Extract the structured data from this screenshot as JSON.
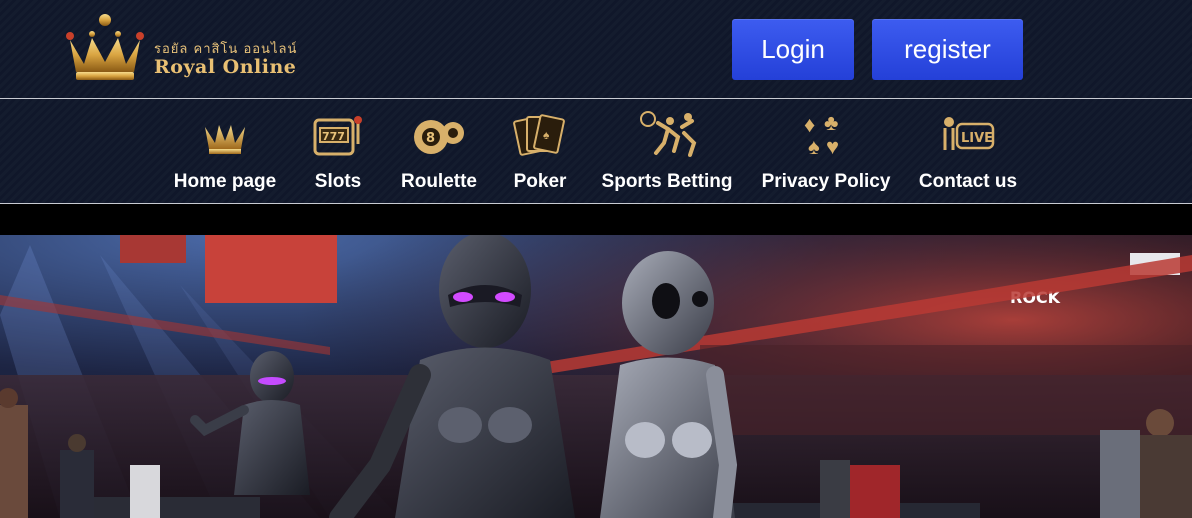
{
  "header": {
    "logo_thai": "รอยัล คาสิโน ออนไลน์",
    "logo_text": "Royal Online",
    "login_label": "Login",
    "register_label": "register"
  },
  "nav": {
    "items": [
      {
        "label": "Home page",
        "icon": "crown-icon"
      },
      {
        "label": "Slots",
        "icon": "slot-machine-icon"
      },
      {
        "label": "Roulette",
        "icon": "roulette-ball-icon"
      },
      {
        "label": "Poker",
        "icon": "playing-cards-icon"
      },
      {
        "label": "Sports Betting",
        "icon": "sports-icon"
      },
      {
        "label": "Privacy Policy",
        "icon": "card-suits-icon"
      },
      {
        "label": "Contact us",
        "icon": "live-icon"
      }
    ]
  },
  "colors": {
    "accent_blue": "#2f4ee6",
    "gold": "#e4b866",
    "header_bg": "#121a2c"
  },
  "hero": {
    "description_icon": "hero-banner-image",
    "banner_text": "ROCK"
  }
}
